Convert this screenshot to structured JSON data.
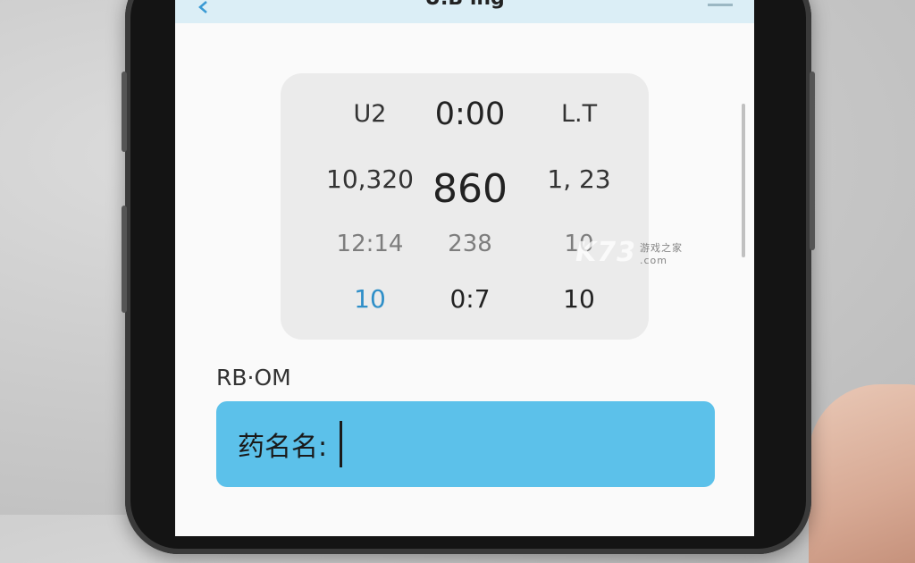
{
  "nav": {
    "title": "U.B ing",
    "back_icon": "chevron-left-icon"
  },
  "picker": {
    "rows": [
      [
        "U2",
        "0:00",
        "L.T"
      ],
      [
        "10,320",
        "860",
        "1, 23"
      ],
      [
        "12:14",
        "238",
        "10"
      ],
      [
        "10",
        "0:7",
        "10"
      ]
    ]
  },
  "field": {
    "label": "RB·OM",
    "prefix": "药名名:"
  },
  "watermark": {
    "text": "K73",
    "sub": "游戏之家",
    "domain": ".com"
  },
  "colors": {
    "topbar": "#dbeef6",
    "input_bg": "#5cc1ea",
    "accent_blue": "#2f8fc8",
    "picker_bg": "#ebebeb"
  }
}
